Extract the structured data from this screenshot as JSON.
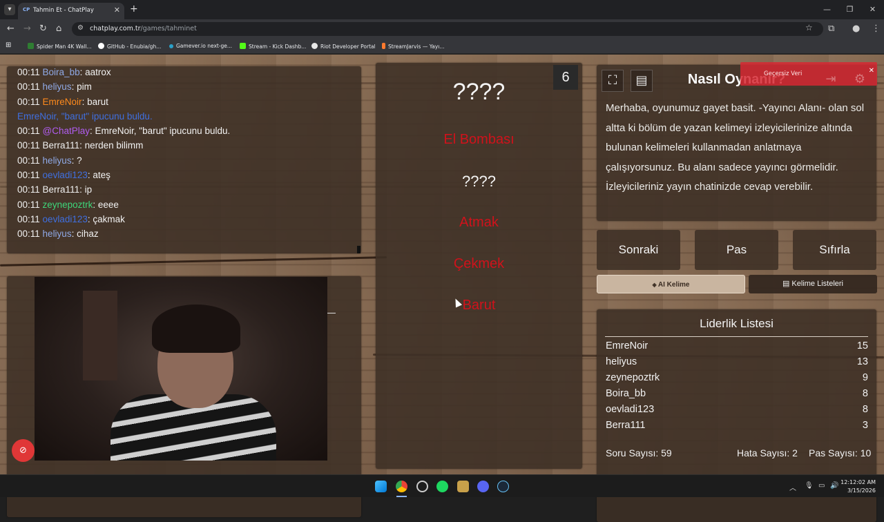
{
  "browser": {
    "tab_title": "Tahmin Et - ChatPlay",
    "tab_favicon": "CP",
    "url_domain": "chatplay.com.tr",
    "url_path": "/games/tahminet",
    "bookmarks": [
      {
        "label": "Spider Man 4K Wall...",
        "color": "#2f7d32"
      },
      {
        "label": "GitHub - Enubia/gh...",
        "color": "#ffffff"
      },
      {
        "label": "Gamever.io next-ge...",
        "color": "#2aa0c8"
      },
      {
        "label": "Stream - Kick Dashb...",
        "color": "#53fc18"
      },
      {
        "label": "Riot Developer Portal",
        "color": "#e8e8e8"
      },
      {
        "label": "StreamJarvis — Yayı...",
        "color": "#ff7a2e"
      }
    ]
  },
  "chat": {
    "messages": [
      {
        "time": "00:11",
        "user": "Boira_bb",
        "color": "#8fa9e6",
        "text": ": aatrox"
      },
      {
        "time": "00:11",
        "user": "heliyus",
        "color": "#8fa9e6",
        "text": ": pim"
      },
      {
        "time": "00:11",
        "user": "EmreNoir",
        "color": "#ff8a1c",
        "text": ": barut"
      },
      {
        "time": "",
        "user": "EmreNoir",
        "color": "#3f6fe0",
        "text": ", \"barut\" ipucunu buldu.",
        "system": true
      },
      {
        "time": "00:11",
        "user": "@ChatPlay",
        "color": "#b05cf0",
        "text": ": EmreNoir, \"barut\" ipucunu buldu."
      },
      {
        "time": "00:11",
        "user": "Berra111",
        "color": "#f0f0f0",
        "text": ": nerden bilimm"
      },
      {
        "time": "00:11",
        "user": "heliyus",
        "color": "#8fa9e6",
        "text": ": ?"
      },
      {
        "time": "00:11",
        "user": "oevladi123",
        "color": "#3f6fe0",
        "text": ": ateş"
      },
      {
        "time": "00:11",
        "user": "Berra111",
        "color": "#f0f0f0",
        "text": ": ip"
      },
      {
        "time": "00:11",
        "user": "zeynepoztrk",
        "color": "#3ed67a",
        "text": ": eeee"
      },
      {
        "time": "00:11",
        "user": "oevladi123",
        "color": "#3f6fe0",
        "text": ": çakmak"
      },
      {
        "time": "00:11",
        "user": "heliyus",
        "color": "#8fa9e6",
        "text": ": cihaz"
      }
    ]
  },
  "game": {
    "counter": "6",
    "main_word": "????",
    "hint_1": "El Bombası",
    "second_word": "????",
    "hint_2": "Atmak",
    "hint_3": "Çekmek",
    "hint_4": "Barut"
  },
  "howto": {
    "title": "Nasıl Oynanır?",
    "text": "Merhaba, oyunumuz gayet basit. -Yayıncı Alanı- olan sol altta ki bölüm de yazan kelimeyi izleyicilerinize altında bulunan kelimeleri kullanmadan anlatmaya çalışıyorsunuz. Bu alanı sadece yayıncı görmelidir. İzleyicileriniz yayın chatinizde cevap verebilir.",
    "fullscreen_icon": "fullscreen-icon",
    "notes_icon": "notes-icon"
  },
  "toast": {
    "text": "Geçersiz Veri",
    "close": "✕"
  },
  "controls": {
    "next": "Sonraki",
    "pass": "Pas",
    "reset": "Sıfırla",
    "ai_word": "AI Kelime",
    "word_lists": "Kelime Listeleri"
  },
  "leaderboard": {
    "title": "Liderlik Listesi",
    "rows": [
      {
        "name": "EmreNoir",
        "score": "15"
      },
      {
        "name": "heliyus",
        "score": "13"
      },
      {
        "name": "zeynepoztrk",
        "score": "9"
      },
      {
        "name": "Boira_bb",
        "score": "8"
      },
      {
        "name": "oevladi123",
        "score": "8"
      },
      {
        "name": "Berra111",
        "score": "3"
      }
    ],
    "questions": "Soru Sayısı: 59",
    "errors": "Hata Sayısı: 2",
    "passes": "Pas Sayısı: 10"
  },
  "taskbar": {
    "time": "12:12:02 AM",
    "date": "3/15/2026"
  }
}
